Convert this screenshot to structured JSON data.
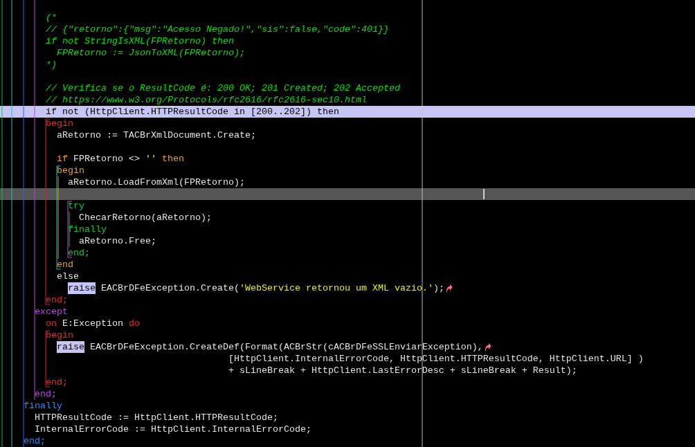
{
  "editor": {
    "lines": [
      {
        "kind": "normal"
      },
      {
        "kind": "normal",
        "tokens": [
          {
            "kind": "comment",
            "text": "        (*"
          }
        ]
      },
      {
        "kind": "normal",
        "tokens": [
          {
            "kind": "comment",
            "text": "        // {\"retorno\":{\"msg\":\"Acesso Negado!\",\"sis\":false,\"code\":401}}"
          }
        ]
      },
      {
        "kind": "normal",
        "tokens": [
          {
            "kind": "comment",
            "text": "        if not StringIsXML(FPRetorno) then"
          }
        ]
      },
      {
        "kind": "normal",
        "tokens": [
          {
            "kind": "comment",
            "text": "          FPRetorno := JsonToXML(FPRetorno);"
          }
        ]
      },
      {
        "kind": "normal",
        "tokens": [
          {
            "kind": "comment",
            "text": "        *)"
          }
        ]
      },
      {
        "kind": "normal"
      },
      {
        "kind": "normal",
        "tokens": [
          {
            "kind": "comment",
            "text": "        // Verifica se o ResultCode é: 200 OK; 201 Created; 202 Accepted"
          }
        ]
      },
      {
        "kind": "normal",
        "tokens": [
          {
            "kind": "comment",
            "text": "        // https://www.w3.org/Protocols/rfc2616/rfc2616-sec10.html"
          }
        ]
      },
      {
        "kind": "selected",
        "tokens": [
          {
            "kind": "plain",
            "text": "        if not (HttpClient.HTTPResultCode in [200..202]) then"
          }
        ]
      },
      {
        "kind": "normal",
        "tokens": [
          {
            "kind": "block",
            "color": "#e82828",
            "text": "        begin"
          }
        ]
      },
      {
        "kind": "normal",
        "tokens": [
          {
            "kind": "plain",
            "text": "          aRetorno := TACBrXmlDocument.Create;"
          }
        ]
      },
      {
        "kind": "normal"
      },
      {
        "kind": "normal",
        "tokens": [
          {
            "kind": "keyword",
            "text": "          if"
          },
          {
            "kind": "plain",
            "text": " FPRetorno <> "
          },
          {
            "kind": "string",
            "text": "''"
          },
          {
            "kind": "keyword",
            "text": " then"
          }
        ]
      },
      {
        "kind": "normal",
        "tokens": [
          {
            "kind": "block",
            "color": "#e8a317",
            "text": "          begin"
          }
        ]
      },
      {
        "kind": "normal",
        "tokens": [
          {
            "kind": "plain",
            "text": "            aRetorno.LoadFromXml(FPRetorno);"
          }
        ]
      },
      {
        "kind": "cursor"
      },
      {
        "kind": "normal",
        "tokens": [
          {
            "kind": "block",
            "color": "#10c840",
            "text": "            try"
          }
        ]
      },
      {
        "kind": "normal",
        "tokens": [
          {
            "kind": "plain",
            "text": "              ChecarRetorno(aRetorno);"
          }
        ]
      },
      {
        "kind": "normal",
        "tokens": [
          {
            "kind": "block",
            "color": "#10c840",
            "text": "            finally"
          }
        ]
      },
      {
        "kind": "normal",
        "tokens": [
          {
            "kind": "plain",
            "text": "              aRetorno.Free;"
          }
        ]
      },
      {
        "kind": "normal",
        "tokens": [
          {
            "kind": "block",
            "color": "#10c840",
            "text": "            end;"
          }
        ]
      },
      {
        "kind": "normal",
        "tokens": [
          {
            "kind": "block",
            "color": "#e8a317",
            "text": "          end"
          }
        ]
      },
      {
        "kind": "normal",
        "tokens": [
          {
            "kind": "plain",
            "text": "          else"
          }
        ]
      },
      {
        "kind": "normal",
        "tokens": [
          {
            "kind": "match",
            "text": "            raise"
          },
          {
            "kind": "plain",
            "text": " EACBrDFeException.Create("
          },
          {
            "kind": "string",
            "text": "'WebService retornou um XML vazio.'"
          },
          {
            "kind": "plain",
            "text": ");"
          },
          {
            "kind": "return-mark"
          }
        ]
      },
      {
        "kind": "normal",
        "tokens": [
          {
            "kind": "block",
            "color": "#e82828",
            "text": "        end;"
          }
        ]
      },
      {
        "kind": "normal",
        "tokens": [
          {
            "kind": "block",
            "color": "#c040e8",
            "text": "      except"
          }
        ]
      },
      {
        "kind": "normal",
        "tokens": [
          {
            "kind": "block",
            "color": "#e82828",
            "text": "        on"
          },
          {
            "kind": "plain",
            "text": " E:Exception "
          },
          {
            "kind": "block",
            "color": "#e82828",
            "text": "do"
          }
        ]
      },
      {
        "kind": "normal",
        "tokens": [
          {
            "kind": "block",
            "color": "#e82828",
            "text": "        begin"
          }
        ]
      },
      {
        "kind": "normal",
        "tokens": [
          {
            "kind": "match",
            "text": "          raise"
          },
          {
            "kind": "plain",
            "text": " EACBrDFeException.CreateDef(Format(ACBrStr(cACBrDFeSSLEnviarException),"
          },
          {
            "kind": "return-mark"
          }
        ]
      },
      {
        "kind": "normal",
        "tokens": [
          {
            "kind": "plain",
            "text": "                                         [HttpClient.InternalErrorCode, HttpClient.HTTPResultCode, HttpClient.URL] )"
          }
        ]
      },
      {
        "kind": "normal",
        "tokens": [
          {
            "kind": "plain",
            "text": "                                         + sLineBreak + HttpClient.LastErrorDesc + sLineBreak + Result);"
          }
        ]
      },
      {
        "kind": "normal",
        "tokens": [
          {
            "kind": "block",
            "color": "#e82828",
            "text": "        end;"
          }
        ]
      },
      {
        "kind": "normal",
        "tokens": [
          {
            "kind": "block",
            "color": "#c040e8",
            "text": "      end;"
          }
        ]
      },
      {
        "kind": "normal",
        "tokens": [
          {
            "kind": "block",
            "color": "#1e90ff",
            "text": "    finally"
          }
        ]
      },
      {
        "kind": "normal",
        "tokens": [
          {
            "kind": "plain",
            "text": "      HTTPResultCode := HttpClient.HTTPResultCode;"
          }
        ]
      },
      {
        "kind": "normal",
        "tokens": [
          {
            "kind": "plain",
            "text": "      InternalErrorCode := HttpClient.InternalErrorCode;"
          }
        ]
      },
      {
        "kind": "normal",
        "tokens": [
          {
            "kind": "block",
            "color": "#1e90ff",
            "text": "    end;"
          }
        ]
      }
    ]
  }
}
